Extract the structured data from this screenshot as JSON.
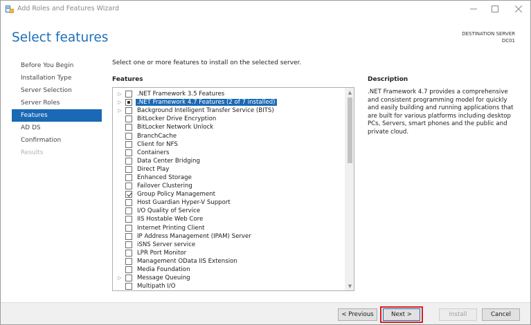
{
  "window": {
    "title": "Add Roles and Features Wizard"
  },
  "header": {
    "page_title": "Select features",
    "destination_label": "DESTINATION SERVER",
    "destination_server": "DC01"
  },
  "nav": {
    "items": [
      {
        "label": "Before You Begin",
        "state": "normal"
      },
      {
        "label": "Installation Type",
        "state": "normal"
      },
      {
        "label": "Server Selection",
        "state": "normal"
      },
      {
        "label": "Server Roles",
        "state": "normal"
      },
      {
        "label": "Features",
        "state": "active"
      },
      {
        "label": "AD DS",
        "state": "normal"
      },
      {
        "label": "Confirmation",
        "state": "normal"
      },
      {
        "label": "Results",
        "state": "disabled"
      }
    ]
  },
  "main": {
    "instruction": "Select one or more features to install on the selected server.",
    "features_label": "Features",
    "description_label": "Description",
    "description_text": ".NET Framework 4.7 provides a comprehensive and consistent programming model for quickly and easily building and running applications that are built for various platforms including desktop PCs, Servers, smart phones and the public and private cloud.",
    "features": [
      {
        "label": ".NET Framework 3.5 Features",
        "expandable": true,
        "check": "none",
        "selected": false
      },
      {
        "label": ".NET Framework 4.7 Features (2 of 7 installed)",
        "expandable": true,
        "check": "partial",
        "selected": true
      },
      {
        "label": "Background Intelligent Transfer Service (BITS)",
        "expandable": true,
        "check": "none",
        "selected": false
      },
      {
        "label": "BitLocker Drive Encryption",
        "expandable": false,
        "check": "none",
        "selected": false
      },
      {
        "label": "BitLocker Network Unlock",
        "expandable": false,
        "check": "none",
        "selected": false
      },
      {
        "label": "BranchCache",
        "expandable": false,
        "check": "none",
        "selected": false
      },
      {
        "label": "Client for NFS",
        "expandable": false,
        "check": "none",
        "selected": false
      },
      {
        "label": "Containers",
        "expandable": false,
        "check": "none",
        "selected": false
      },
      {
        "label": "Data Center Bridging",
        "expandable": false,
        "check": "none",
        "selected": false
      },
      {
        "label": "Direct Play",
        "expandable": false,
        "check": "none",
        "selected": false
      },
      {
        "label": "Enhanced Storage",
        "expandable": false,
        "check": "none",
        "selected": false
      },
      {
        "label": "Failover Clustering",
        "expandable": false,
        "check": "none",
        "selected": false
      },
      {
        "label": "Group Policy Management",
        "expandable": false,
        "check": "checked",
        "selected": false
      },
      {
        "label": "Host Guardian Hyper-V Support",
        "expandable": false,
        "check": "none",
        "selected": false
      },
      {
        "label": "I/O Quality of Service",
        "expandable": false,
        "check": "none",
        "selected": false
      },
      {
        "label": "IIS Hostable Web Core",
        "expandable": false,
        "check": "none",
        "selected": false
      },
      {
        "label": "Internet Printing Client",
        "expandable": false,
        "check": "none",
        "selected": false
      },
      {
        "label": "IP Address Management (IPAM) Server",
        "expandable": false,
        "check": "none",
        "selected": false
      },
      {
        "label": "iSNS Server service",
        "expandable": false,
        "check": "none",
        "selected": false
      },
      {
        "label": "LPR Port Monitor",
        "expandable": false,
        "check": "none",
        "selected": false
      },
      {
        "label": "Management OData IIS Extension",
        "expandable": false,
        "check": "none",
        "selected": false
      },
      {
        "label": "Media Foundation",
        "expandable": false,
        "check": "none",
        "selected": false
      },
      {
        "label": "Message Queuing",
        "expandable": true,
        "check": "none",
        "selected": false
      },
      {
        "label": "Multipath I/O",
        "expandable": false,
        "check": "none",
        "selected": false
      }
    ]
  },
  "footer": {
    "previous_label": "< Previous",
    "next_label": "Next >",
    "install_label": "Install",
    "cancel_label": "Cancel"
  },
  "colors": {
    "accent": "#1a69b5",
    "title_blue": "#1c6fb8",
    "highlight_red": "#e01b1b"
  }
}
